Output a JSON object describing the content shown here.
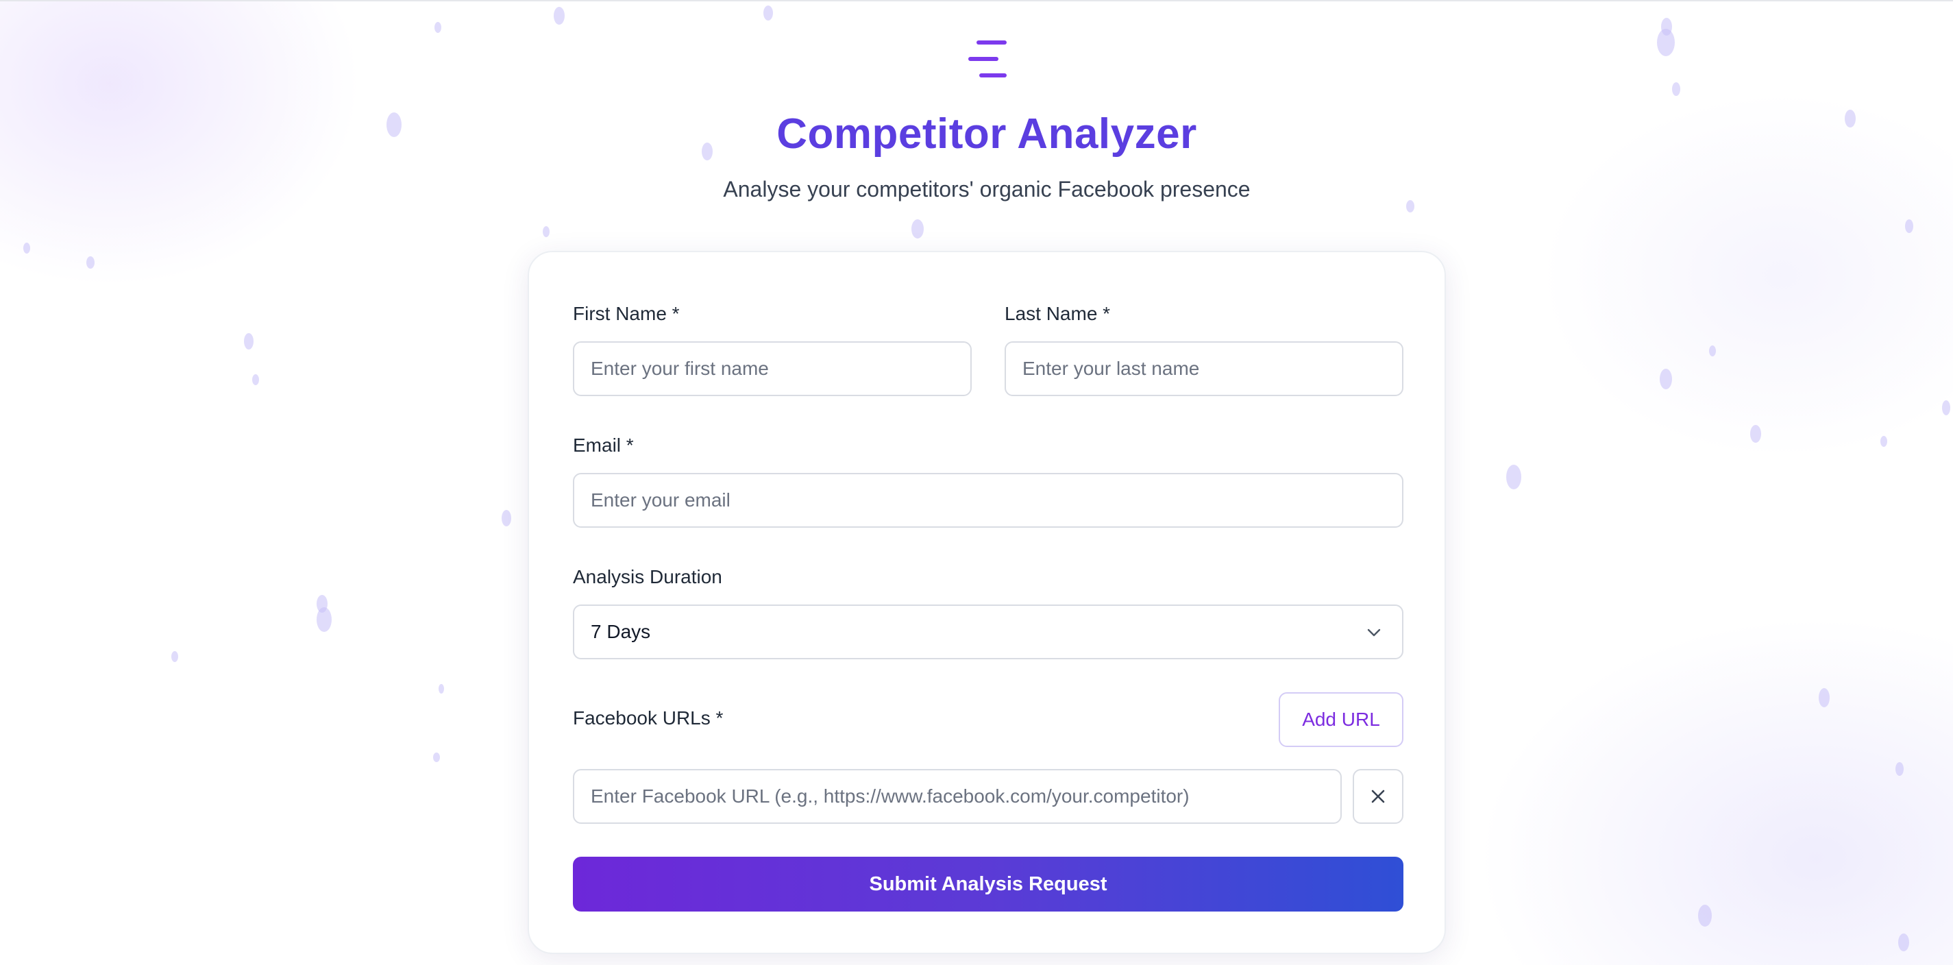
{
  "app": {
    "title": "Competitor Analyzer",
    "subtitle": "Analyse your competitors' organic Facebook presence",
    "logo_icon": "menu-lines-icon",
    "accent_color": "#5b3ee0"
  },
  "form": {
    "first_name": {
      "label": "First Name *",
      "value": "",
      "placeholder": "Enter your first name"
    },
    "last_name": {
      "label": "Last Name *",
      "value": "",
      "placeholder": "Enter your last name"
    },
    "email": {
      "label": "Email *",
      "value": "",
      "placeholder": "Enter your email"
    },
    "duration": {
      "label": "Analysis Duration",
      "selected": "7 Days",
      "icon": "chevron-down-icon"
    },
    "facebook_urls": {
      "label": "Facebook URLs *",
      "add_button": "Add URL",
      "urls": [
        {
          "value": "",
          "placeholder": "Enter Facebook URL (e.g., https://www.facebook.com/your.competitor)",
          "remove_icon": "close-icon"
        }
      ]
    },
    "submit_label": "Submit Analysis Request",
    "submit_gradient": [
      "#6d28d9",
      "#2f4fd6"
    ]
  }
}
